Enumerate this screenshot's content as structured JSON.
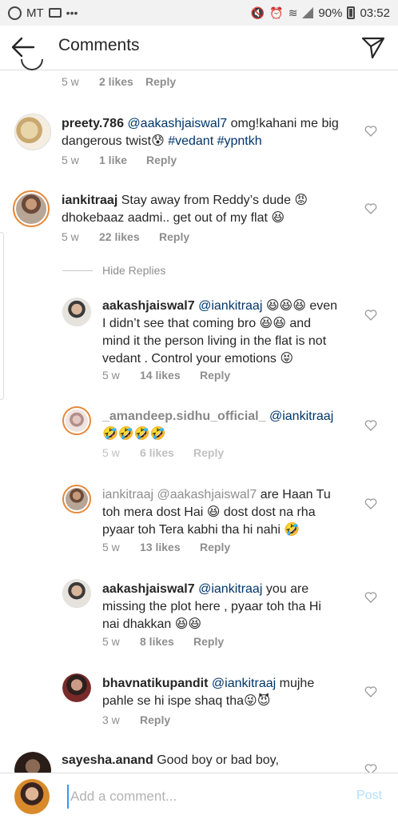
{
  "status_bar": {
    "left_label": "MT",
    "dots": "•••",
    "battery": "90%",
    "time": "03:52"
  },
  "header": {
    "title": "Comments"
  },
  "comments": [
    {
      "id": "c0",
      "time": "5 w",
      "likes": "2 likes",
      "reply": "Reply"
    },
    {
      "id": "c1",
      "username": "preety.786",
      "mention": "@aakashjaiswal7",
      "text": "omg!kahani me big dangerous twist😰",
      "tags": "#vedant #ypntkh",
      "time": "5 w",
      "likes": "1 like",
      "reply": "Reply"
    },
    {
      "id": "c2",
      "username": "iankitraaj",
      "text_line1": "Stay away from Reddy’s dude 😡",
      "text_line2": "dhokebaaz aadmi.. get out of my flat 😆",
      "time": "5 w",
      "likes": "22 likes",
      "reply": "Reply"
    }
  ],
  "hide_replies": "Hide Replies",
  "replies": [
    {
      "username": "aakashjaiswal7",
      "mention": "@iankitraaj",
      "line1_rest": "😆😆😆 even",
      "line2": "I didn’t see that coming bro 😆😆 and",
      "line3": "mind it the person living in the flat is not",
      "line4": "vedant . Control your emotions 😝",
      "time": "5 w",
      "likes": "14 likes",
      "reply": "Reply"
    },
    {
      "username": "_amandeep.sidhu_official_",
      "mention": "@iankitraaj",
      "line2": "🤣🤣🤣🤣",
      "time": "5 w",
      "likes": "6 likes",
      "reply": "Reply"
    },
    {
      "username": "iankitraaj",
      "mention": "@aakashjaiswal7",
      "line1_rest": "are Haan Tu",
      "line2": "toh mera dost Hai 😆 dost dost na rha",
      "line3": "pyaar toh Tera kabhi tha hi nahi 🤣",
      "time": "5 w",
      "likes": "13 likes",
      "reply": "Reply"
    },
    {
      "username": "aakashjaiswal7",
      "mention": "@iankitraaj",
      "line1_rest": "you are",
      "line2": "missing the plot here , pyaar toh tha Hi",
      "line3": "nai dhakkan 😆😆",
      "time": "5 w",
      "likes": "8 likes",
      "reply": "Reply"
    },
    {
      "username": "bhavnatikupandit",
      "mention": "@iankitraaj",
      "line1_rest": "mujhe",
      "line2": "pahle se hi ispe shaq tha😜😈",
      "time": "3 w",
      "reply": "Reply"
    }
  ],
  "last_comment": {
    "username": "sayesha.anand",
    "text": "Good boy or bad boy,"
  },
  "composer": {
    "placeholder": "Add a comment...",
    "post_label": "Post"
  }
}
